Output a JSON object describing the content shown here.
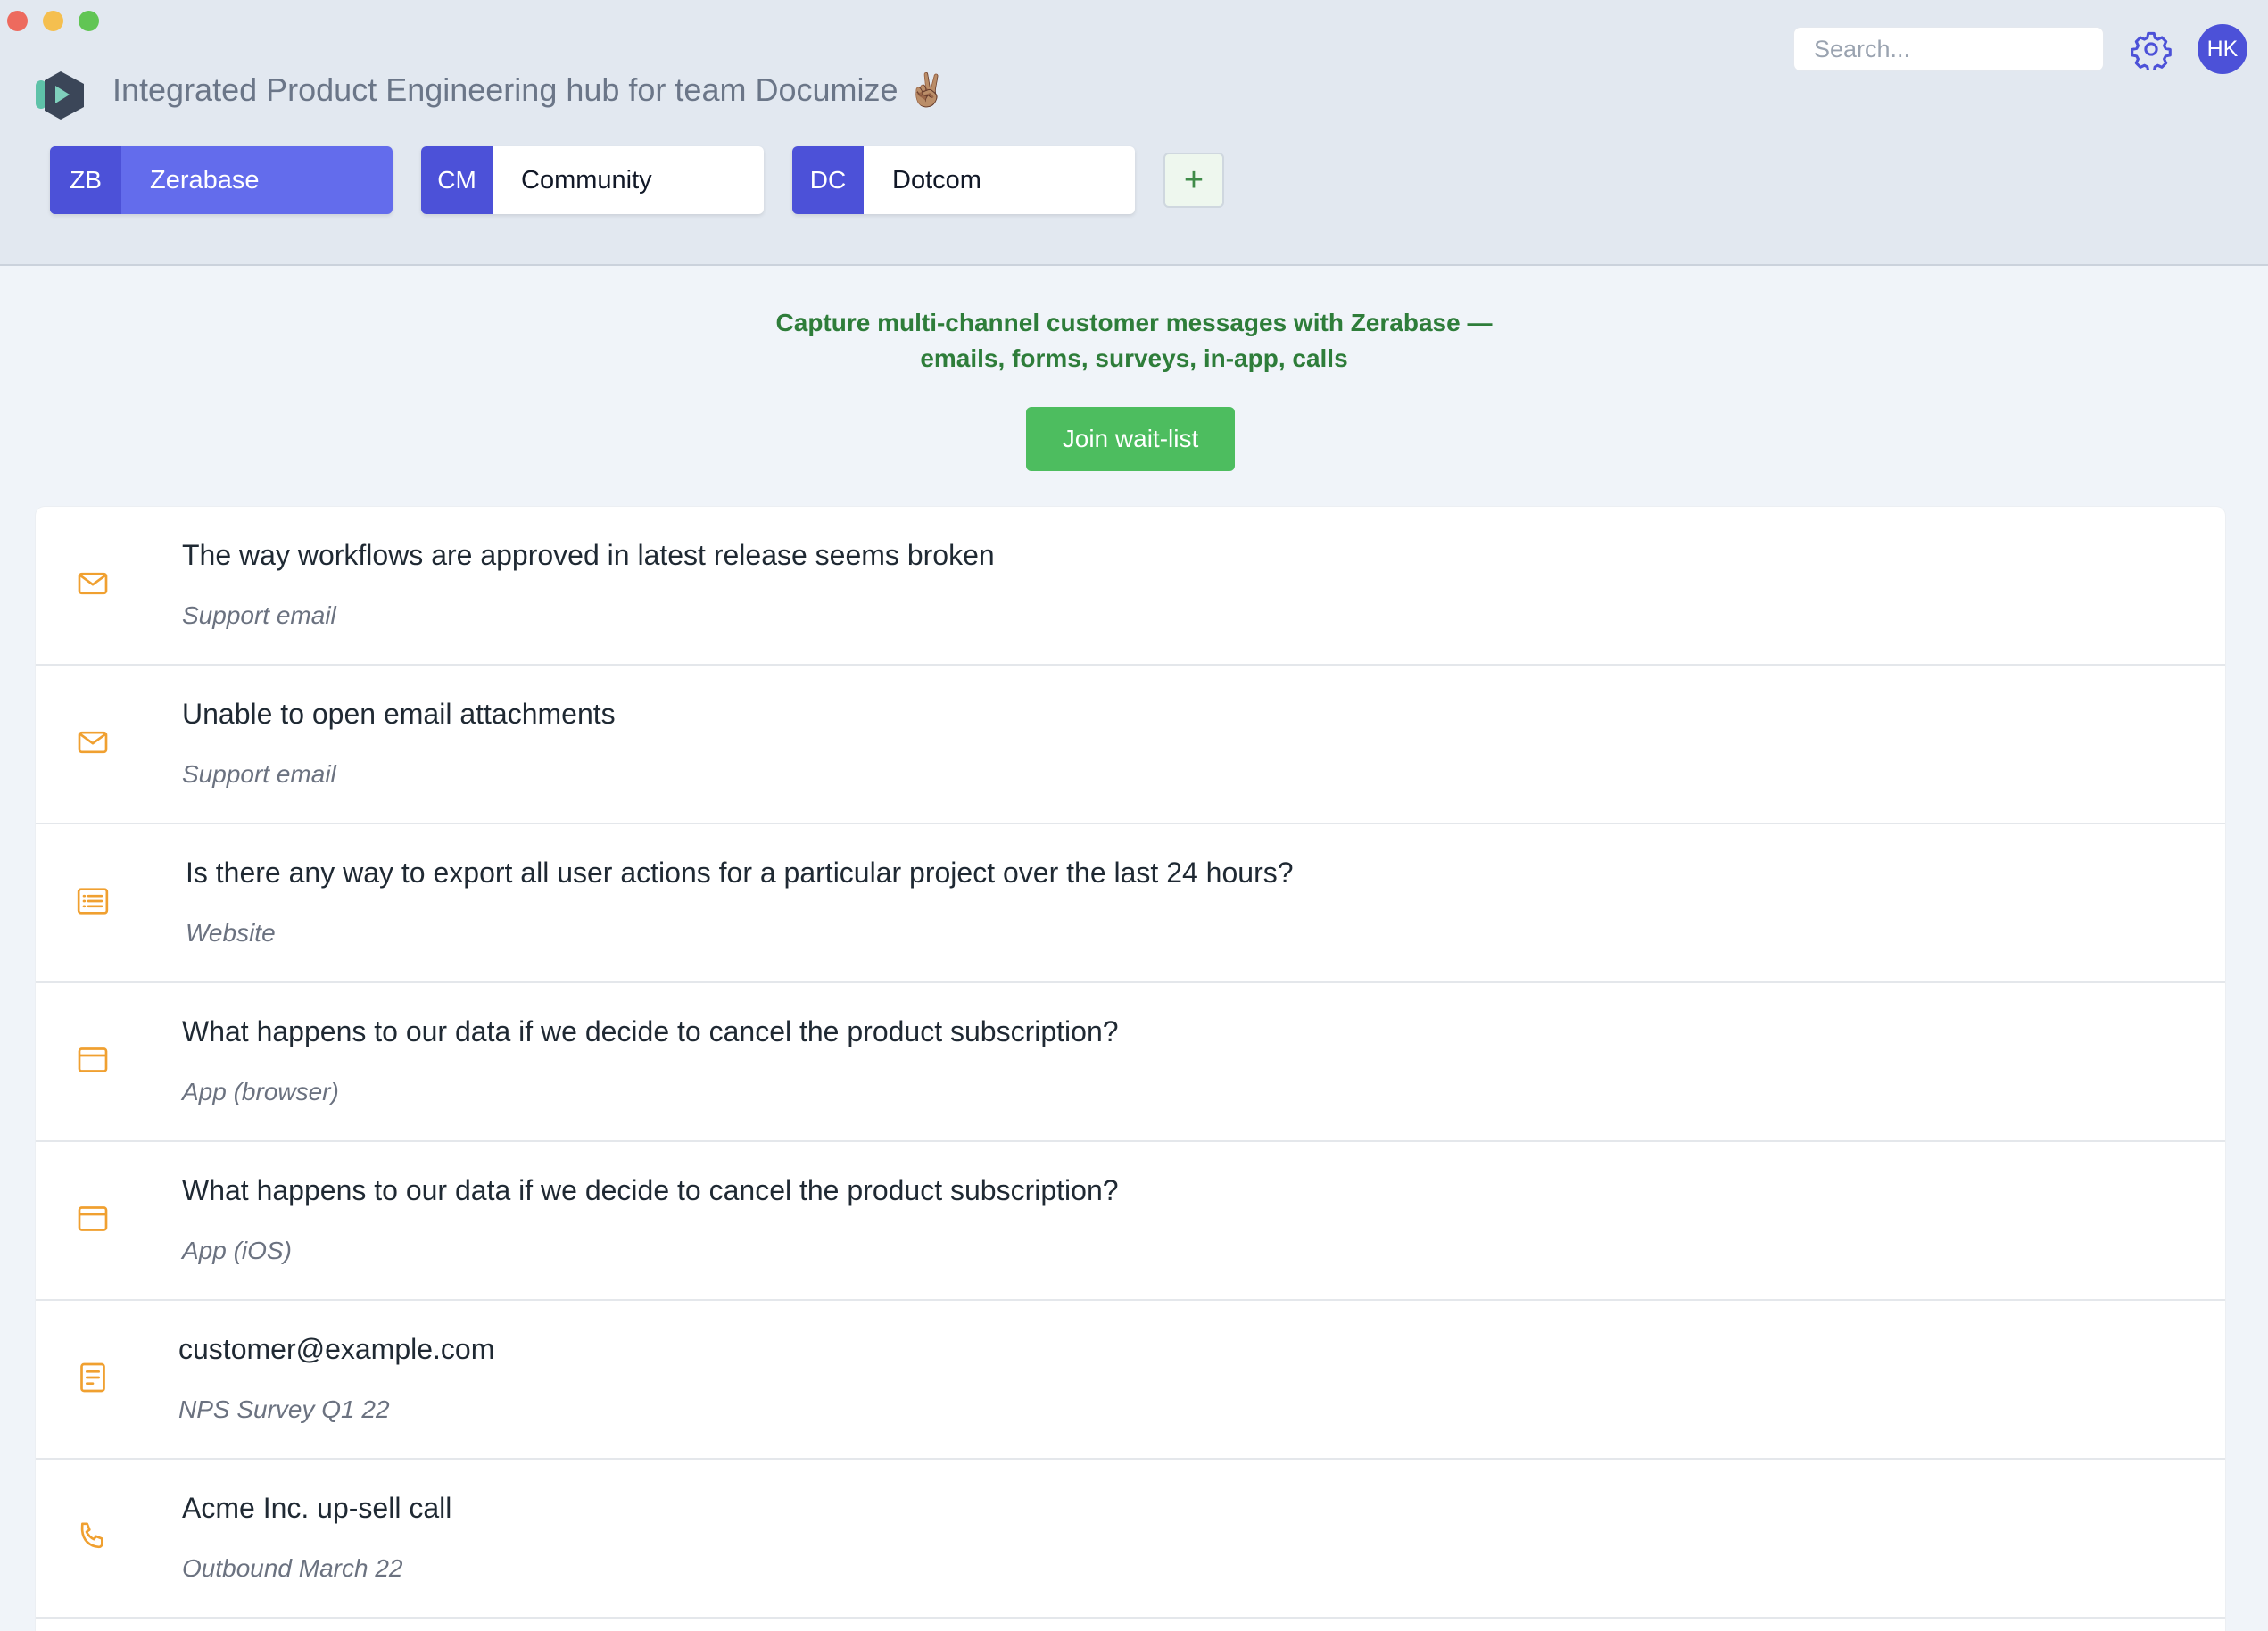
{
  "window": {
    "title": "Integrated Product Engineering hub for team Documize ✌🏽"
  },
  "header": {
    "search": {
      "placeholder": "Search...",
      "value": ""
    },
    "avatar_initials": "HK",
    "spaces": [
      {
        "abbr": "ZB",
        "name": "Zerabase",
        "active": true
      },
      {
        "abbr": "CM",
        "name": "Community",
        "active": false
      },
      {
        "abbr": "DC",
        "name": "Dotcom",
        "active": false
      }
    ],
    "add_space_label": "+"
  },
  "promo": {
    "line1": "Capture multi-channel customer messages with Zerabase —",
    "line2": "emails, forms, surveys, in-app, calls",
    "button_label": "Join wait-list"
  },
  "messages": [
    {
      "title": "The way workflows are approved in latest release seems broken",
      "source": "Support email",
      "icon": "mail-icon"
    },
    {
      "title": "Unable to open email attachments",
      "source": "Support email",
      "icon": "mail-icon"
    },
    {
      "title": "Is there any way to export all user actions for a particular project over the last 24 hours?",
      "source": "Website",
      "icon": "list-icon"
    },
    {
      "title": "What happens to our data if we decide to cancel the product subscription?",
      "source": "App (browser)",
      "icon": "browser-window-icon"
    },
    {
      "title": "What happens to our data if we decide to cancel the product subscription?",
      "source": "App (iOS)",
      "icon": "browser-window-icon"
    },
    {
      "title": "customer@example.com",
      "source": "NPS Survey Q1 22",
      "icon": "survey-form-icon"
    },
    {
      "title": "Acme Inc. up-sell call",
      "source": "Outbound March 22",
      "icon": "phone-icon"
    }
  ],
  "colors": {
    "accent": "#4c51d8",
    "active_space": "#636cec",
    "success": "#4dbd5f",
    "promo_text": "#2e7d3a",
    "icon_orange": "#f0a030"
  }
}
